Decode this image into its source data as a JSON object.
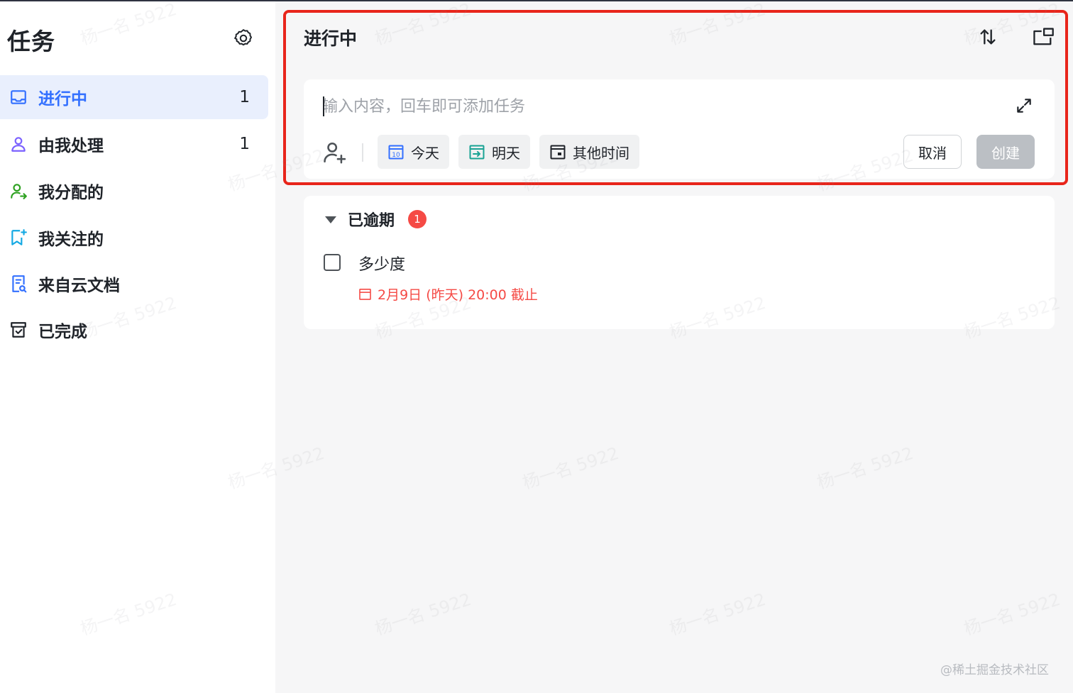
{
  "sidebar": {
    "title": "任务",
    "items": [
      {
        "label": "进行中",
        "count": "1",
        "icon": "inbox-icon",
        "active": true
      },
      {
        "label": "由我处理",
        "count": "1",
        "icon": "person-icon"
      },
      {
        "label": "我分配的",
        "count": "",
        "icon": "person-assign-icon"
      },
      {
        "label": "我关注的",
        "count": "",
        "icon": "bookmark-star-icon"
      },
      {
        "label": "来自云文档",
        "count": "",
        "icon": "doc-icon"
      },
      {
        "label": "已完成",
        "count": "",
        "icon": "archive-icon"
      }
    ]
  },
  "main": {
    "title": "进行中",
    "composer": {
      "placeholder": "输入内容，回车即可添加任务",
      "chips": [
        {
          "label": "今天",
          "icon": "calendar-today-icon"
        },
        {
          "label": "明天",
          "icon": "calendar-tomorrow-icon"
        },
        {
          "label": "其他时间",
          "icon": "calendar-other-icon"
        }
      ],
      "cancel_label": "取消",
      "create_label": "创建"
    },
    "section": {
      "title": "已逾期",
      "badge": "1",
      "tasks": [
        {
          "title": "多少度",
          "due": "2月9日 (昨天) 20:00 截止"
        }
      ]
    }
  },
  "watermark_text": "杨一名 5922",
  "credit": "@稀土掘金技术社区",
  "colors": {
    "accent": "#3370ff",
    "active_bg": "#e9effd",
    "danger": "#f54a45",
    "highlight_border": "#e8251b",
    "disabled_button": "#bbbfc4"
  }
}
